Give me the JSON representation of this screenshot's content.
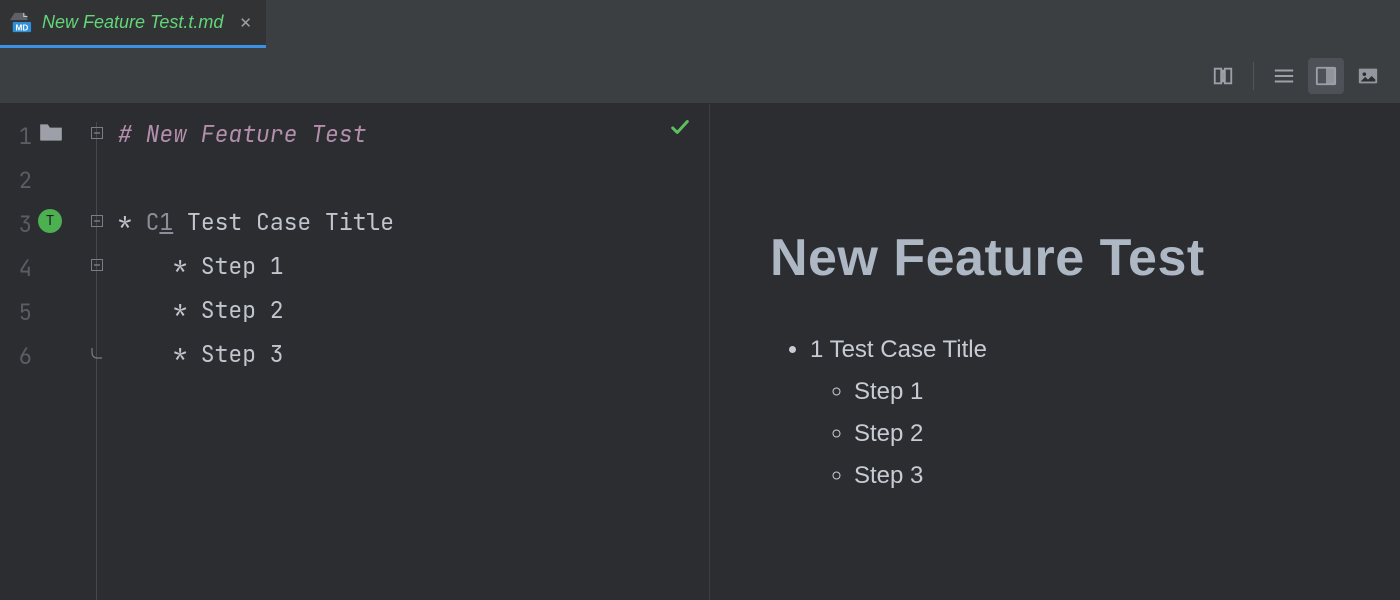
{
  "tab": {
    "filename": "New Feature Test.t.md",
    "md_badge": "MD"
  },
  "toolbar": {
    "scroll_sync": "scroll-sync",
    "view_source": "source-only",
    "view_split": "split-view",
    "view_preview": "preview-only"
  },
  "editor": {
    "lines": [
      {
        "num": "1",
        "gutter": "folder",
        "fold": "minus",
        "segments": [
          {
            "cls": "tok-hash",
            "text": "# "
          },
          {
            "cls": "tok-title",
            "text": "New Feature Test"
          }
        ]
      },
      {
        "num": "2",
        "gutter": "",
        "fold": "",
        "segments": []
      },
      {
        "num": "3",
        "gutter": "t-badge",
        "fold": "minus",
        "segments": [
          {
            "cls": "tok-star",
            "text": "* "
          },
          {
            "cls": "tok-grey",
            "text": "C"
          },
          {
            "cls": "tok-grey underline",
            "text": "1"
          },
          {
            "cls": "tok-plain",
            "text": " Test Case Title"
          }
        ]
      },
      {
        "num": "4",
        "gutter": "",
        "fold": "minus",
        "segments": [
          {
            "cls": "tok-plain",
            "text": "    * Step 1"
          }
        ]
      },
      {
        "num": "5",
        "gutter": "",
        "fold": "",
        "segments": [
          {
            "cls": "tok-plain",
            "text": "    * Step 2"
          }
        ]
      },
      {
        "num": "6",
        "gutter": "",
        "fold": "end",
        "segments": [
          {
            "cls": "tok-plain",
            "text": "    * Step 3"
          }
        ]
      }
    ],
    "t_badge_label": "T"
  },
  "preview": {
    "heading": "New Feature Test",
    "item1": "1 Test Case Title",
    "step1": "Step 1",
    "step2": "Step 2",
    "step3": "Step 3"
  }
}
